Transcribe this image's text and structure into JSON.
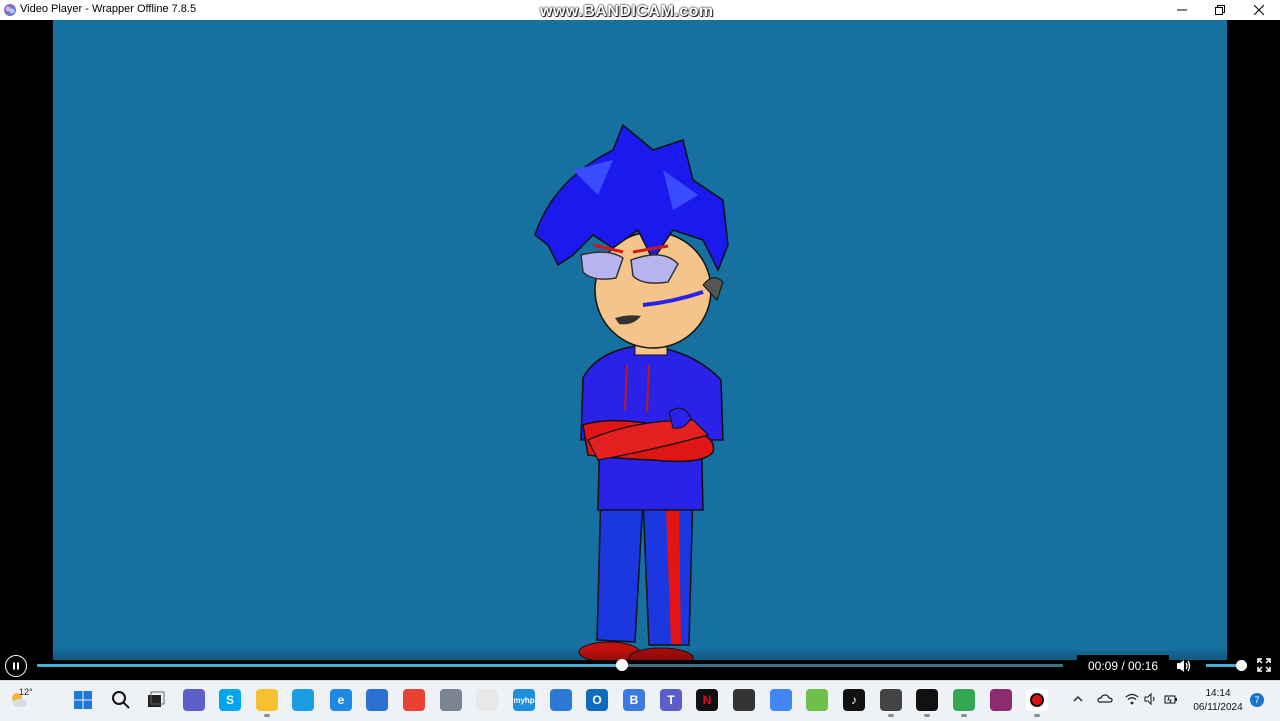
{
  "window": {
    "title": "Video Player - Wrapper Offline 7.8.5",
    "watermark": "www.BANDICAM.com"
  },
  "colors": {
    "video_background": "#1671a0",
    "progress_fill": "#42b0d6",
    "taskbar": "#eef1f6"
  },
  "player": {
    "state": "playing",
    "time_display": "00:09 / 00:16",
    "progress_fraction": 0.57,
    "volume_fraction": 1.0,
    "icons": [
      "pause-icon",
      "volume-icon",
      "fullscreen-icon"
    ]
  },
  "taskbar": {
    "weather_temp": "12°",
    "clock_time": "14:14",
    "clock_date": "06/11/2024",
    "notification_count": "7",
    "pinned_apps": [
      {
        "name": "start",
        "glyph": ""
      },
      {
        "name": "search",
        "glyph": ""
      },
      {
        "name": "task-view",
        "glyph": ""
      },
      {
        "name": "chat",
        "glyph": ""
      },
      {
        "name": "skype",
        "glyph": "S"
      },
      {
        "name": "file-explorer",
        "glyph": ""
      },
      {
        "name": "edge",
        "glyph": ""
      },
      {
        "name": "ie",
        "glyph": "e"
      },
      {
        "name": "store",
        "glyph": ""
      },
      {
        "name": "chrome",
        "glyph": ""
      },
      {
        "name": "settings",
        "glyph": ""
      },
      {
        "name": "clock",
        "glyph": ""
      },
      {
        "name": "myhp",
        "glyph": "myhp"
      },
      {
        "name": "mail",
        "glyph": ""
      },
      {
        "name": "outlook",
        "glyph": "O"
      },
      {
        "name": "bitwarden",
        "glyph": "B"
      },
      {
        "name": "teams",
        "glyph": "T"
      },
      {
        "name": "netflix",
        "glyph": "N"
      },
      {
        "name": "screen-recorder",
        "glyph": ""
      },
      {
        "name": "chrome-2",
        "glyph": ""
      },
      {
        "name": "whatsapp",
        "glyph": ""
      },
      {
        "name": "tiktok",
        "glyph": "♪"
      },
      {
        "name": "wrapper-offline",
        "glyph": ""
      },
      {
        "name": "capcut",
        "glyph": ""
      },
      {
        "name": "chrome-3",
        "glyph": ""
      },
      {
        "name": "winrar",
        "glyph": ""
      },
      {
        "name": "bandicam",
        "glyph": ""
      }
    ]
  }
}
